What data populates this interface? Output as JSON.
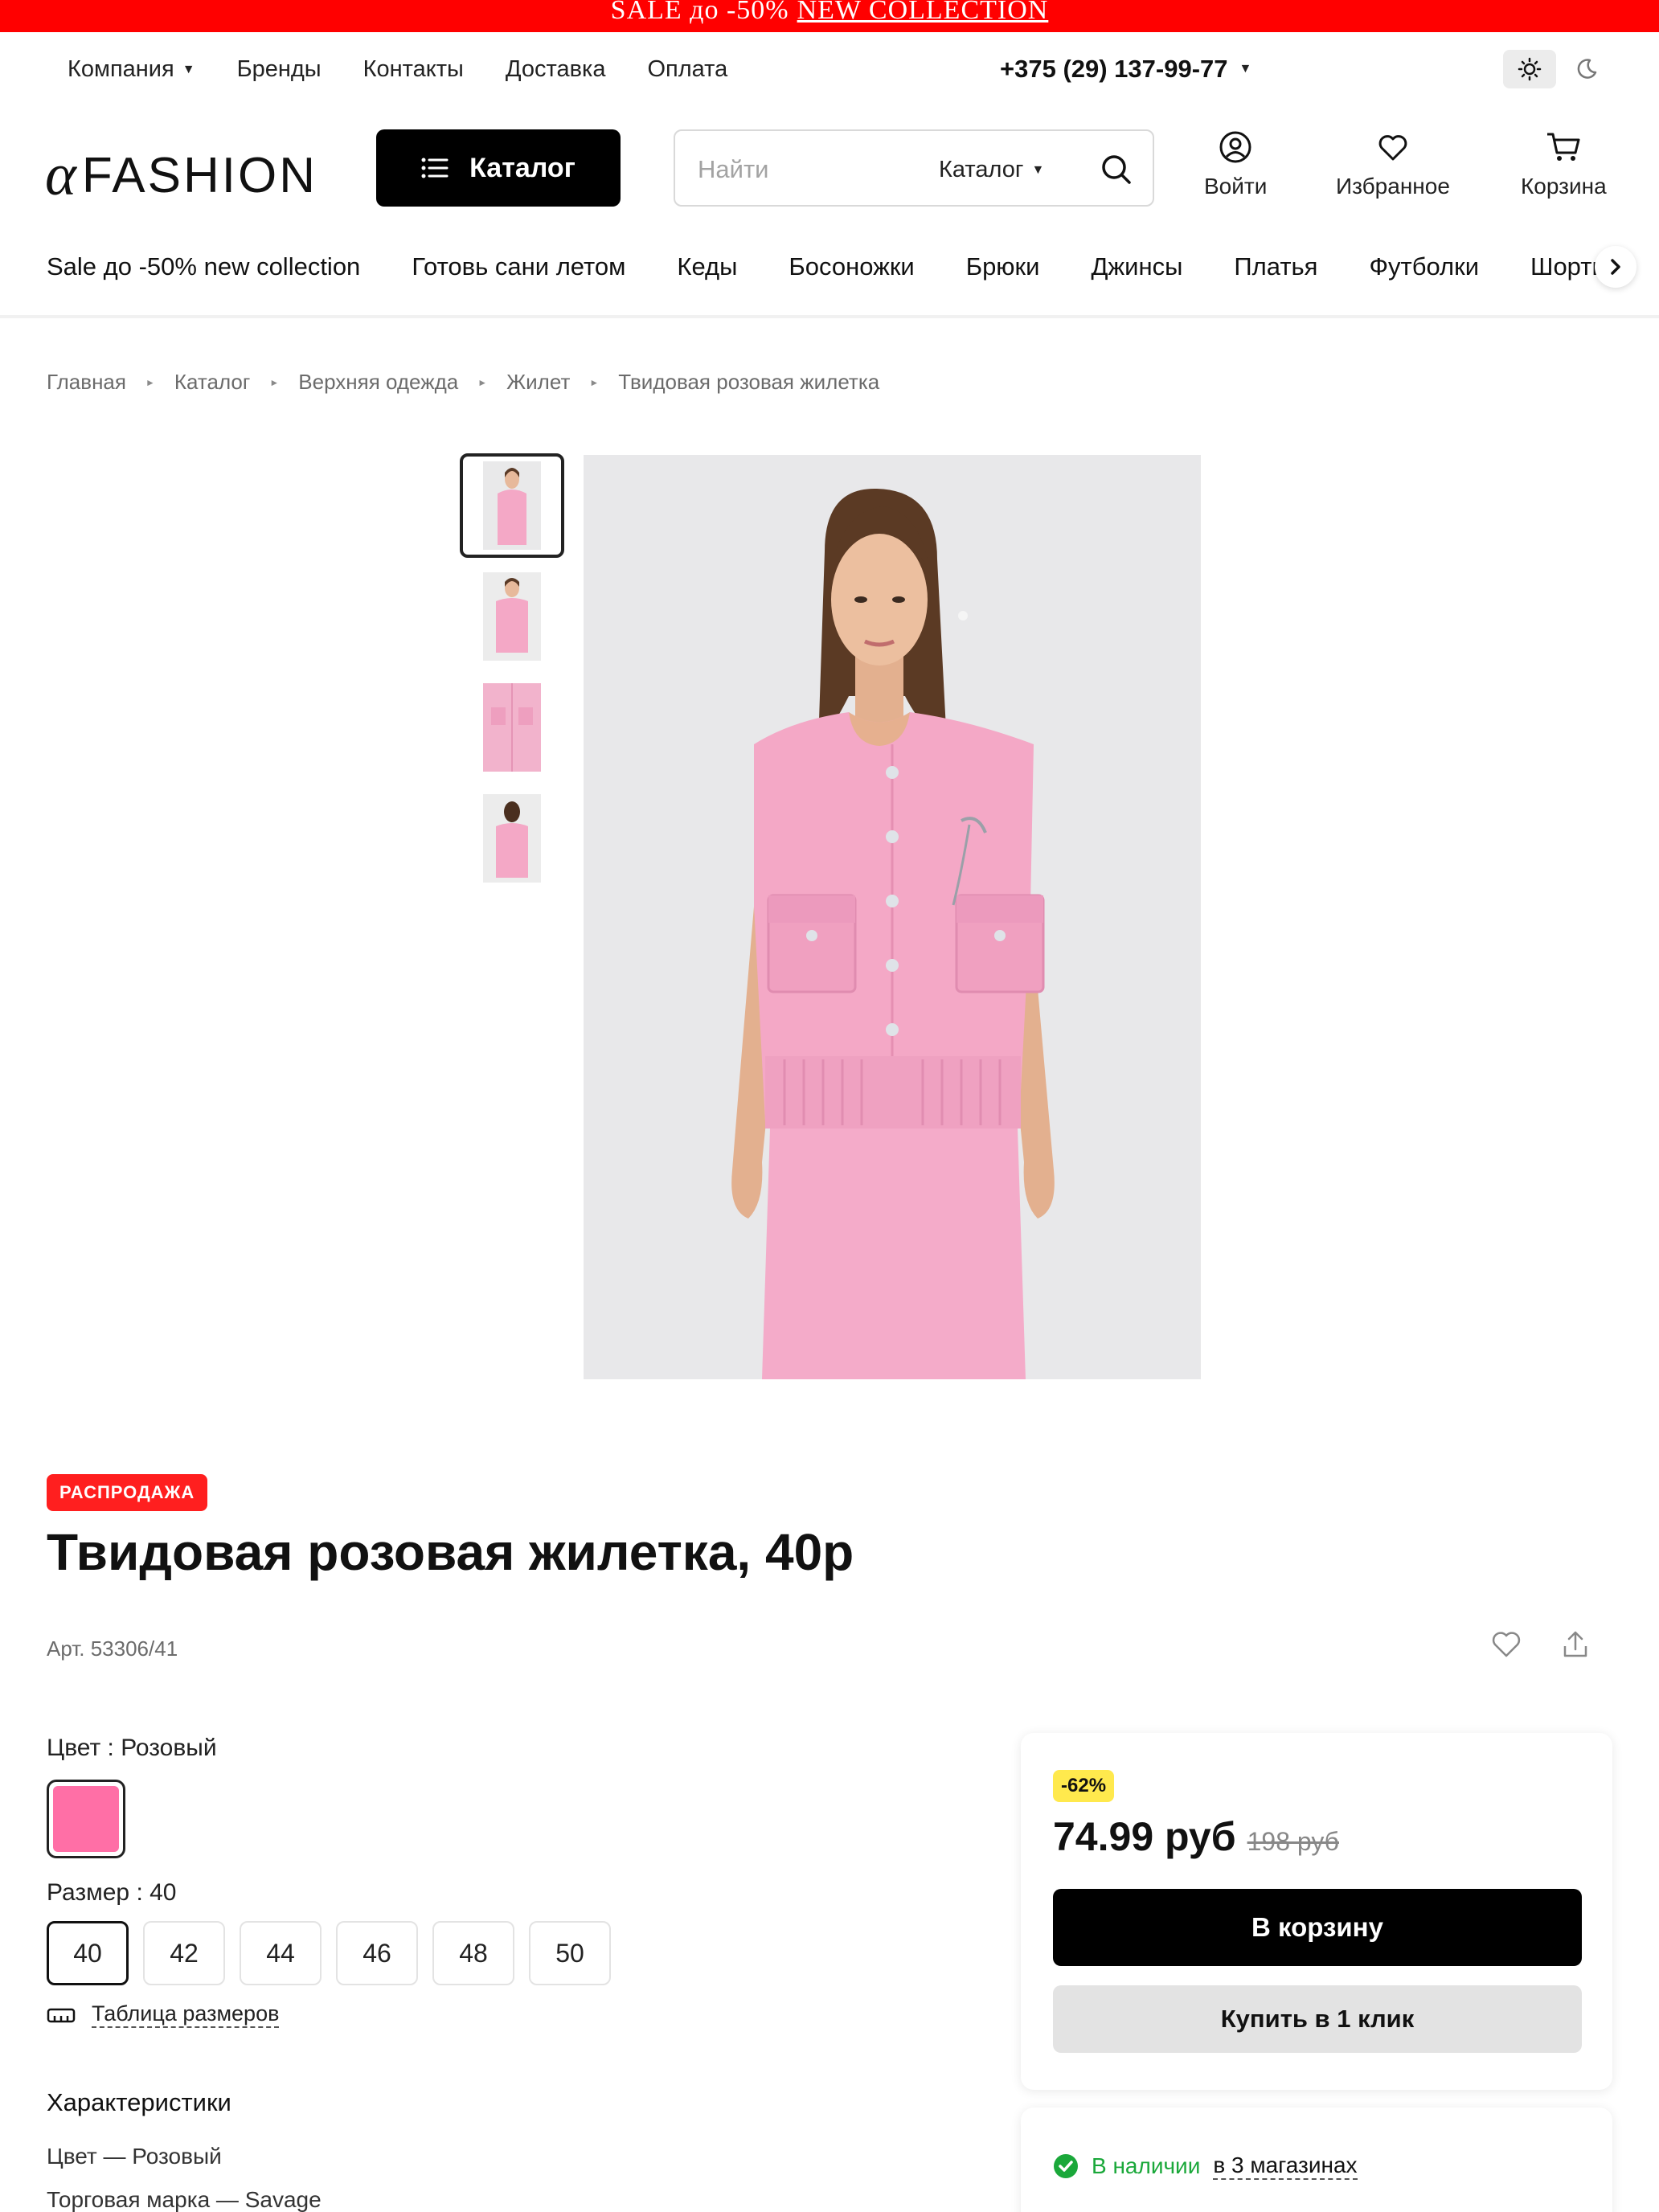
{
  "promo": {
    "text": "SALE до -50%",
    "link": "NEW COLLECTION"
  },
  "topnav": {
    "items": [
      "Компания",
      "Бренды",
      "Контакты",
      "Доставка",
      "Оплата"
    ],
    "phone": "+375 (29) 137-99-77"
  },
  "header": {
    "logo_text": "FASHION",
    "catalog_label": "Каталог",
    "search_placeholder": "Найти",
    "search_scope": "Каталог",
    "login_label": "Войти",
    "favorites_label": "Избранное",
    "cart_label": "Корзина"
  },
  "catnav": {
    "items": [
      "Sale до -50% new collection",
      "Готовь сани летом",
      "Кеды",
      "Босоножки",
      "Брюки",
      "Джинсы",
      "Платья",
      "Футболки",
      "Шорты"
    ]
  },
  "breadcrumb": [
    "Главная",
    "Каталог",
    "Верхняя одежда",
    "Жилет",
    "Твидовая розовая жилетка"
  ],
  "product": {
    "badge": "РАСПРОДАЖА",
    "title": "Твидовая розовая жилетка, 40р",
    "sku": "Арт. 53306/41",
    "color_label": "Цвет : Розовый",
    "swatch_color": "#ff6fa6",
    "size_label": "Размер : 40",
    "sizes": [
      "40",
      "42",
      "44",
      "46",
      "48",
      "50"
    ],
    "selected_size": "40",
    "size_table_label": "Таблица размеров",
    "characteristics_title": "Характеристики",
    "characteristics": [
      "Цвет — Розовый",
      "Торговая марка — Savage"
    ]
  },
  "buy": {
    "discount": "-62%",
    "price": "74.99 руб",
    "old_price": "198 руб",
    "cart_button": "В корзину",
    "one_click_button": "Купить в 1 клик",
    "stock_text": "В наличии",
    "stock_link": "в 3 магазинах"
  },
  "colors": {
    "promo": "#ff0000",
    "badge": "#ff1f1f",
    "discount": "#ffe94d",
    "in_stock": "#1aa83a",
    "garment": "#f4a8c6"
  }
}
